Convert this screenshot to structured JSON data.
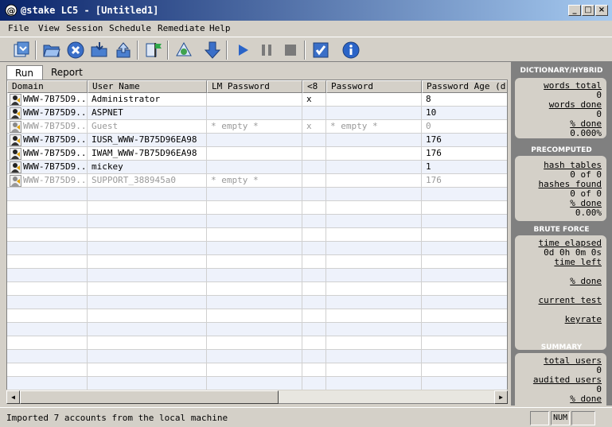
{
  "window": {
    "title": "@stake LC5 - [Untitled1]",
    "min": "_",
    "max": "□",
    "close": "×"
  },
  "menu": [
    "File",
    "View",
    "Session",
    "Schedule",
    "Remediate",
    "Help"
  ],
  "tabs": [
    "Run",
    "Report"
  ],
  "columns": [
    "Domain",
    "User Name",
    "LM Password",
    "<8",
    "Password",
    "Password Age (d..."
  ],
  "rows": [
    {
      "domain": "WWW-7B75D9...",
      "user": "Administrator",
      "lm": "",
      "lt8": "x",
      "password": "",
      "age": "8",
      "disabled": false
    },
    {
      "domain": "WWW-7B75D9...",
      "user": "ASPNET",
      "lm": "",
      "lt8": "",
      "password": "",
      "age": "10",
      "disabled": false
    },
    {
      "domain": "WWW-7B75D9...",
      "user": "Guest",
      "lm": "* empty *",
      "lt8": "x",
      "password": "* empty *",
      "age": "0",
      "disabled": true
    },
    {
      "domain": "WWW-7B75D9...",
      "user": "IUSR_WWW-7B75D96EA98",
      "lm": "",
      "lt8": "",
      "password": "",
      "age": "176",
      "disabled": false
    },
    {
      "domain": "WWW-7B75D9...",
      "user": "IWAM_WWW-7B75D96EA98",
      "lm": "",
      "lt8": "",
      "password": "",
      "age": "176",
      "disabled": false
    },
    {
      "domain": "WWW-7B75D9...",
      "user": "mickey",
      "lm": "",
      "lt8": "",
      "password": "",
      "age": "1",
      "disabled": false
    },
    {
      "domain": "WWW-7B75D9...",
      "user": "SUPPORT_388945a0",
      "lm": "* empty *",
      "lt8": "",
      "password": "",
      "age": "176",
      "disabled": true
    }
  ],
  "panel": {
    "dictionary": {
      "title": "DICTIONARY/HYBRID",
      "words_total_label": "words total",
      "words_total": "0",
      "words_done_label": "words done",
      "words_done": "0",
      "pct_label": "% done",
      "pct": "0.000%"
    },
    "precomputed": {
      "title": "PRECOMPUTED",
      "hash_tables_label": "hash tables",
      "hash_tables": "0 of 0",
      "hashes_found_label": "hashes found",
      "hashes_found": "0 of 0",
      "pct_label": "% done",
      "pct": "0.00%"
    },
    "brute": {
      "title": "BRUTE FORCE",
      "time_elapsed_label": "time elapsed",
      "time_elapsed": "0d 0h 0m 0s",
      "time_left_label": "time left",
      "pct_label": "% done",
      "current_test_label": "current test",
      "keyrate_label": "keyrate"
    },
    "summary": {
      "title": "SUMMARY",
      "total_users_label": "total users",
      "total_users": "0",
      "audited_users_label": "audited users",
      "audited_users": "0",
      "pct_label": "% done"
    }
  },
  "status": {
    "text": "Imported 7 accounts from the local machine",
    "num": "NUM"
  },
  "colors": {
    "title_start": "#0a246a",
    "title_end": "#a6caf0",
    "panel_bg": "#808080",
    "row_alt": "#eef2fb"
  }
}
